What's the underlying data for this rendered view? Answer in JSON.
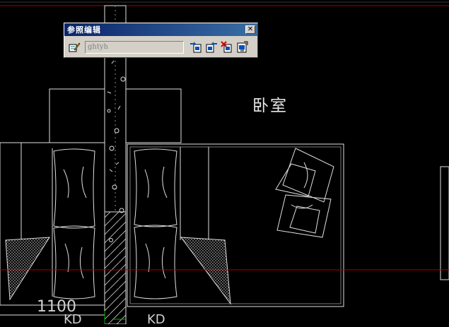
{
  "toolbar": {
    "title": "参照编辑",
    "close_glyph": "✕",
    "reference_name_placeholder": "ghtyh",
    "buttons": [
      {
        "name": "edit-reference-icon"
      },
      {
        "name": "add-to-workset-icon"
      },
      {
        "name": "remove-from-workset-icon"
      },
      {
        "name": "discard-changes-icon"
      },
      {
        "name": "save-back-changes-icon"
      }
    ]
  },
  "drawing": {
    "room_label": "卧室",
    "dimension_1100": "1100",
    "dimension_kd_left": "KD",
    "dimension_kd_right": "KD"
  },
  "colors": {
    "background": "#000000",
    "linework": "#e0e0e0",
    "reference_line": "#c00000",
    "toolbar_face": "#d4d0c8",
    "titlebar": "#0a246a"
  }
}
